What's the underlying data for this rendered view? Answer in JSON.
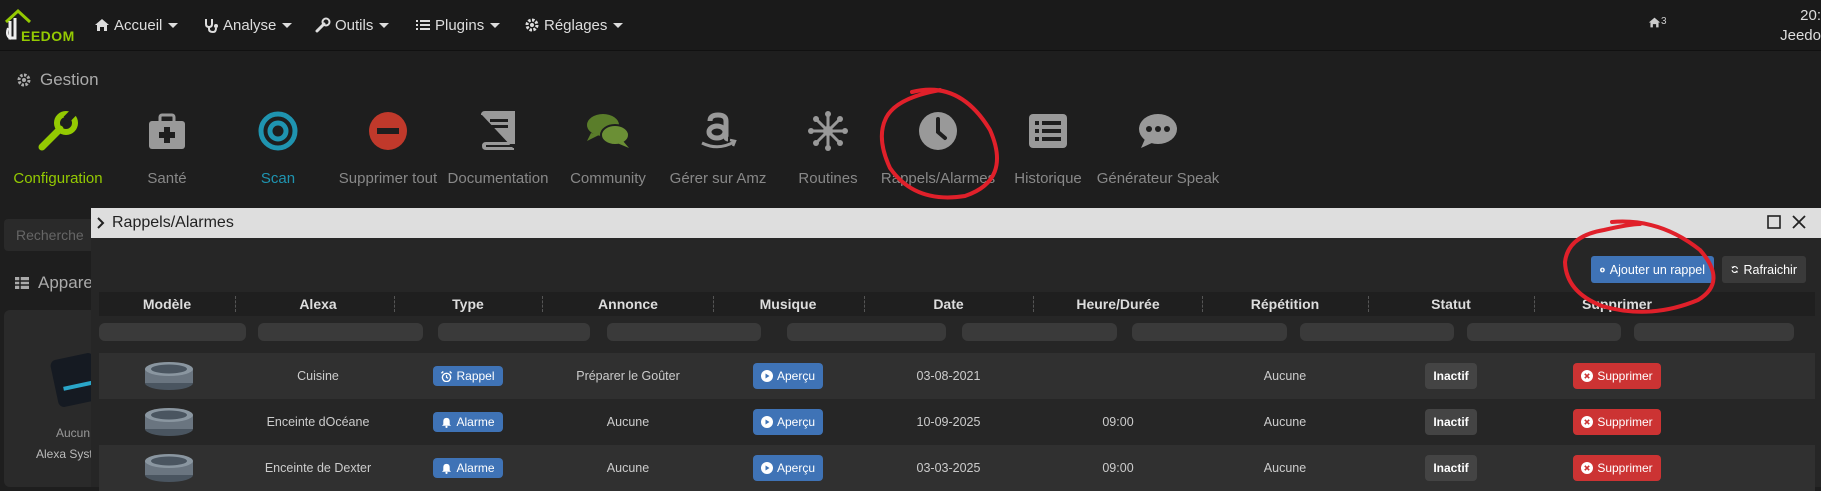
{
  "topbar": {
    "logo_text": "EEDOM",
    "nav": [
      {
        "label": "Accueil",
        "icon": "home-icon"
      },
      {
        "label": "Analyse",
        "icon": "stethoscope-icon"
      },
      {
        "label": "Outils",
        "icon": "wrench-icon"
      },
      {
        "label": "Plugins",
        "icon": "list-icon"
      },
      {
        "label": "Réglages",
        "icon": "gear-icon"
      }
    ],
    "home_count": "3",
    "clock_time": "20:",
    "clock_name": "Jeedo"
  },
  "gestion": {
    "title": "Gestion",
    "tiles": [
      {
        "label": "Configuration",
        "icon": "wrench-icon",
        "color": "#94ca02"
      },
      {
        "label": "Santé",
        "icon": "medkit-icon",
        "color": "#999999"
      },
      {
        "label": "Scan",
        "icon": "target-icon",
        "color": "#1f94b0"
      },
      {
        "label": "Supprimer tout",
        "icon": "minus-circle-icon",
        "color": "#c0392b"
      },
      {
        "label": "Documentation",
        "icon": "book-icon",
        "color": "#999999"
      },
      {
        "label": "Community",
        "icon": "comments-icon",
        "color": "#5a7d2a"
      },
      {
        "label": "Gérer sur Amz",
        "icon": "amazon-icon",
        "color": "#999999"
      },
      {
        "label": "Routines",
        "icon": "asterisk-icon",
        "color": "#999999"
      },
      {
        "label": "Rappels/Alarmes",
        "icon": "clock-icon",
        "color": "#999999"
      },
      {
        "label": "Historique",
        "icon": "list-alt-icon",
        "color": "#999999"
      },
      {
        "label": "Générateur Speak",
        "icon": "comment-dots-icon",
        "color": "#999999"
      }
    ]
  },
  "background": {
    "search_placeholder": "Recherche",
    "section_title": "Appare",
    "card_line1": "Aucun",
    "card_line2": "Alexa Syst"
  },
  "modal": {
    "title": "Rappels/Alarmes",
    "add_label": "Ajouter un rappel",
    "refresh_label": "Rafraichir",
    "columns": [
      "Modèle",
      "Alexa",
      "Type",
      "Annonce",
      "Musique",
      "Date",
      "Heure/Durée",
      "Répétition",
      "Statut",
      "Supprimer"
    ],
    "play_label": "Aperçu",
    "delete_label": "Supprimer",
    "rows": [
      {
        "alexa": "Cuisine",
        "type": "Rappel",
        "type_icon": "alarm-clock-icon",
        "annonce": "Préparer le Goûter",
        "date": "03-08-2021",
        "heure": "",
        "repetition": "Aucune",
        "statut": "Inactif"
      },
      {
        "alexa": "Enceinte dOcéane",
        "type": "Alarme",
        "type_icon": "bell-icon",
        "annonce": "Aucune",
        "date": "10-09-2025",
        "heure": "09:00",
        "repetition": "Aucune",
        "statut": "Inactif"
      },
      {
        "alexa": "Enceinte de Dexter",
        "type": "Alarme",
        "type_icon": "bell-icon",
        "annonce": "Aucune",
        "date": "03-03-2025",
        "heure": "09:00",
        "repetition": "Aucune",
        "statut": "Inactif"
      }
    ]
  },
  "colors": {
    "accent": "#3f73b6",
    "danger": "#cc3333",
    "brand": "#94ca02",
    "annotation": "#e0202a"
  }
}
